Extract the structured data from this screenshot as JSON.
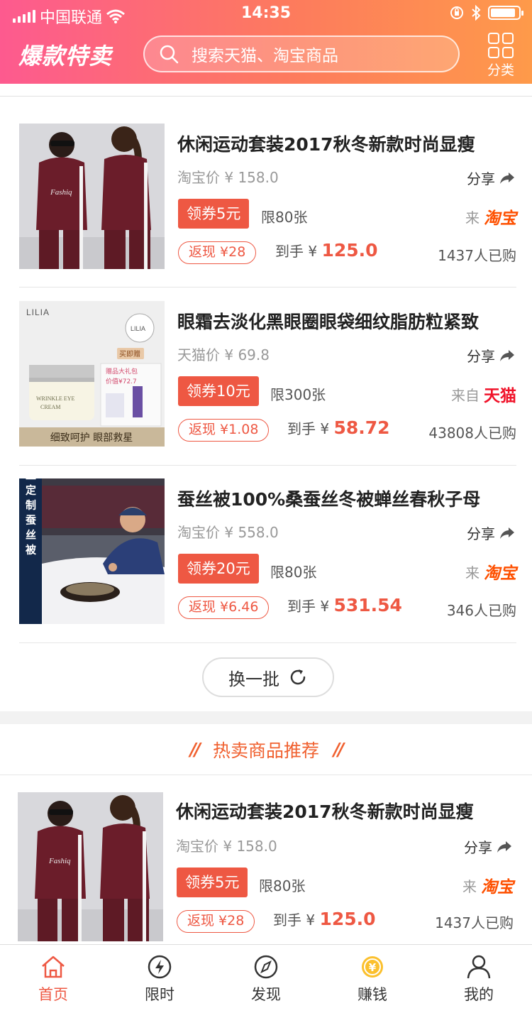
{
  "status_bar": {
    "carrier": "中国联通",
    "time": "14:35"
  },
  "header": {
    "logo": "爆款特卖",
    "search_placeholder": "搜索天猫、淘宝商品",
    "category_label": "分类"
  },
  "products": [
    {
      "title": "休闲运动套装2017秋冬新款时尚显瘦",
      "orig_price_text": "淘宝价 ¥ 158.0",
      "share_label": "分享",
      "coupon_label": "领券5元",
      "limit_text": "限80张",
      "source_prefix": "来",
      "source_name": "淘宝",
      "cashback_label": "返现 ¥28",
      "final_prefix": "到手 ¥",
      "final_price": "125.0",
      "sold_text": "1437人已购"
    },
    {
      "title": "眼霜去淡化黑眼圈眼袋细纹脂肪粒紧致",
      "orig_price_text": "天猫价 ¥ 69.8",
      "share_label": "分享",
      "coupon_label": "领券10元",
      "limit_text": "限300张",
      "source_prefix": "来自",
      "source_name": "天猫",
      "cashback_label": "返现 ¥1.08",
      "final_prefix": "到手 ¥",
      "final_price": "58.72",
      "sold_text": "43808人已购",
      "image_text": {
        "brand": "LILIA",
        "banner": "细致呵护  眼部救星",
        "tag": "买即赠",
        "gift": "赠品大礼包",
        "gift_price": "价值¥72.7"
      }
    },
    {
      "title": "蚕丝被100%桑蚕丝冬被蝉丝春秋子母",
      "orig_price_text": "淘宝价 ¥ 558.0",
      "share_label": "分享",
      "coupon_label": "领券20元",
      "limit_text": "限80张",
      "source_prefix": "来",
      "source_name": "淘宝",
      "cashback_label": "返现 ¥6.46",
      "final_prefix": "到手 ¥",
      "final_price": "531.54",
      "sold_text": "346人已购",
      "image_text": {
        "vertical": "手工定制蚕丝被"
      }
    }
  ],
  "refresh_label": "换一批",
  "recommend_title": "热卖商品推荐",
  "recommend_item": {
    "title": "休闲运动套装2017秋冬新款时尚显瘦",
    "orig_price_text": "淘宝价 ¥ 158.0",
    "share_label": "分享",
    "coupon_label": "领券5元",
    "limit_text": "限80张",
    "source_prefix": "来",
    "source_name": "淘宝",
    "cashback_label": "返现 ¥28",
    "final_prefix": "到手 ¥",
    "final_price": "125.0",
    "sold_text": "1437人已购"
  },
  "tabbar": [
    {
      "label": "首页",
      "icon": "home-icon",
      "active": true
    },
    {
      "label": "限时",
      "icon": "flash-icon",
      "active": false
    },
    {
      "label": "发现",
      "icon": "compass-icon",
      "active": false
    },
    {
      "label": "赚钱",
      "icon": "coin-icon",
      "active": false
    },
    {
      "label": "我的",
      "icon": "user-icon",
      "active": false
    }
  ],
  "colors": {
    "accent": "#ee5843",
    "header_start": "#fd5a8f",
    "header_end": "#fe9a4a",
    "taobao": "#fe5000",
    "tmall": "#f0132a"
  }
}
